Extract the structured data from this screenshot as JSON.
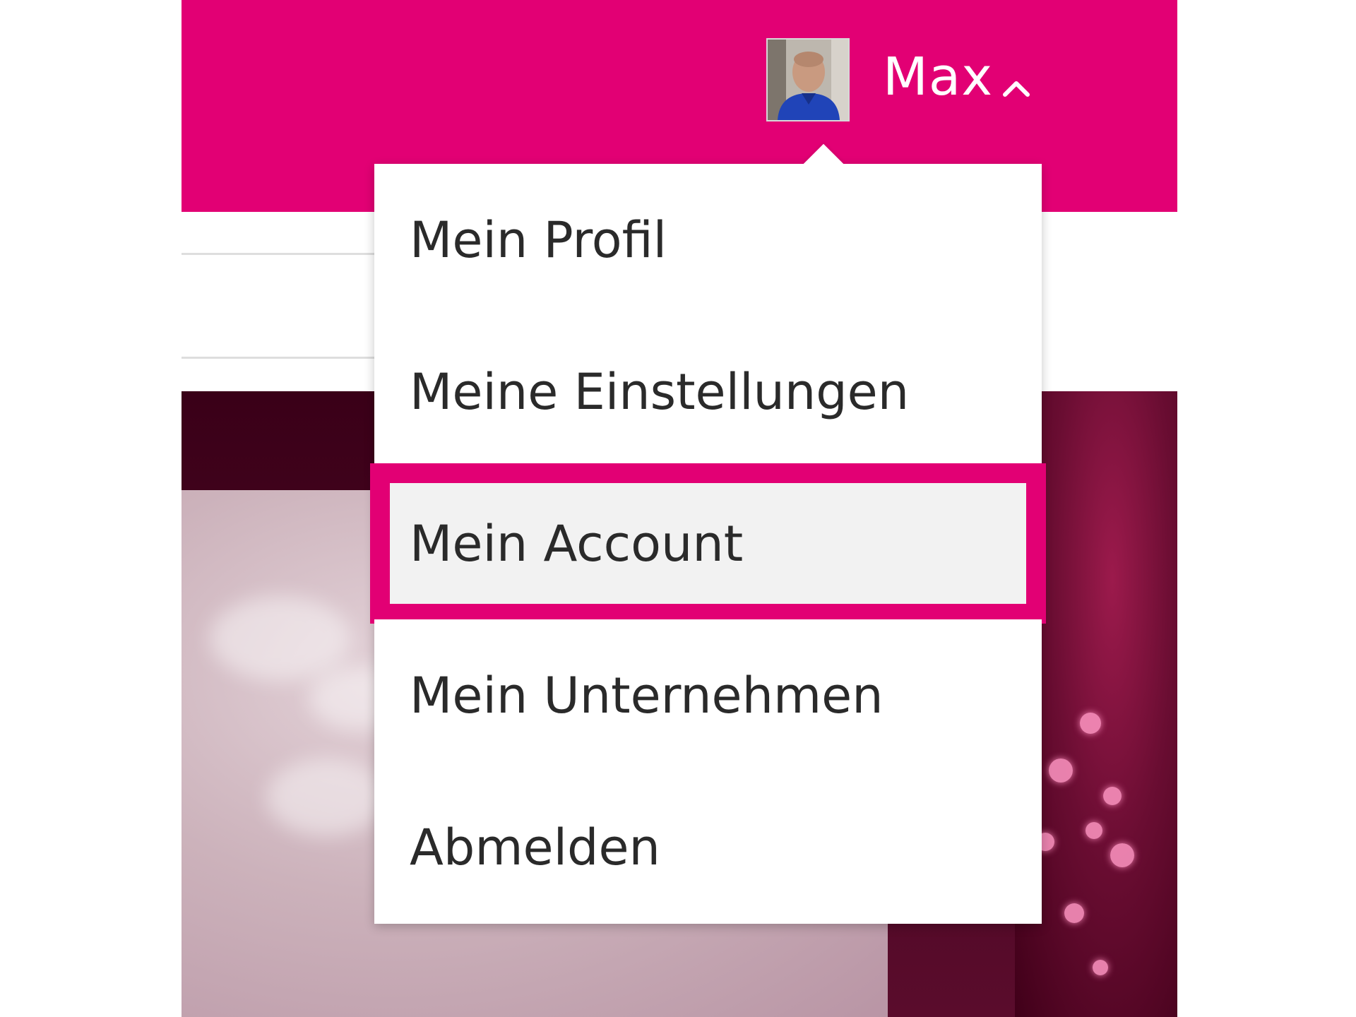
{
  "colors": {
    "brand_magenta": "#e20074",
    "menu_text": "#2a2a2a",
    "menu_focus_bg": "#f2f2f2",
    "header_text": "#ffffff"
  },
  "header": {
    "user": {
      "name": "Max",
      "avatar_icon": "user-avatar-photo",
      "toggle_icon": "chevron-up-icon",
      "menu_expanded": true
    }
  },
  "user_menu": {
    "items": [
      {
        "label": "Mein Profil",
        "focused": false
      },
      {
        "label": "Meine Einstellungen",
        "focused": false
      },
      {
        "label": "Mein Account",
        "focused": true
      },
      {
        "label": "Mein Unternehmen",
        "focused": false
      },
      {
        "label": "Abmelden",
        "focused": false
      }
    ]
  }
}
